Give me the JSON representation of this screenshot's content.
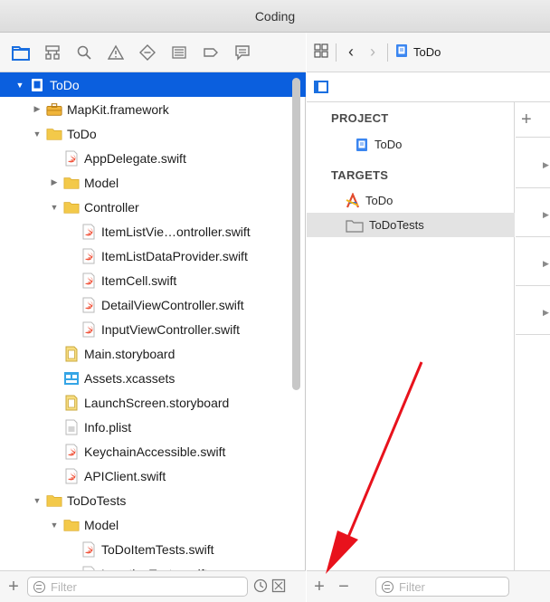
{
  "window": {
    "title": "Coding"
  },
  "navigator": {
    "tabs": [
      "project-navigator-icon",
      "source-control-icon",
      "find-icon",
      "issue-icon",
      "test-icon",
      "debug-icon",
      "breakpoint-icon",
      "report-icon"
    ],
    "tree": [
      {
        "label": "ToDo",
        "depth": 0,
        "disclosure": "open",
        "icon": "xcode-project-icon",
        "selected": true
      },
      {
        "label": "MapKit.framework",
        "depth": 1,
        "disclosure": "closed",
        "icon": "framework-icon"
      },
      {
        "label": "ToDo",
        "depth": 1,
        "disclosure": "open",
        "icon": "folder-icon"
      },
      {
        "label": "AppDelegate.swift",
        "depth": 2,
        "disclosure": "none",
        "icon": "swift-file-icon"
      },
      {
        "label": "Model",
        "depth": 2,
        "disclosure": "closed",
        "icon": "folder-icon"
      },
      {
        "label": "Controller",
        "depth": 2,
        "disclosure": "open",
        "icon": "folder-icon"
      },
      {
        "label": "ItemListVie…ontroller.swift",
        "depth": 3,
        "disclosure": "none",
        "icon": "swift-file-icon"
      },
      {
        "label": "ItemListDataProvider.swift",
        "depth": 3,
        "disclosure": "none",
        "icon": "swift-file-icon"
      },
      {
        "label": "ItemCell.swift",
        "depth": 3,
        "disclosure": "none",
        "icon": "swift-file-icon"
      },
      {
        "label": "DetailViewController.swift",
        "depth": 3,
        "disclosure": "none",
        "icon": "swift-file-icon"
      },
      {
        "label": "InputViewController.swift",
        "depth": 3,
        "disclosure": "none",
        "icon": "swift-file-icon"
      },
      {
        "label": "Main.storyboard",
        "depth": 2,
        "disclosure": "none",
        "icon": "storyboard-icon"
      },
      {
        "label": "Assets.xcassets",
        "depth": 2,
        "disclosure": "none",
        "icon": "asset-catalog-icon"
      },
      {
        "label": "LaunchScreen.storyboard",
        "depth": 2,
        "disclosure": "none",
        "icon": "storyboard-icon"
      },
      {
        "label": "Info.plist",
        "depth": 2,
        "disclosure": "none",
        "icon": "plist-icon"
      },
      {
        "label": "KeychainAccessible.swift",
        "depth": 2,
        "disclosure": "none",
        "icon": "swift-file-icon"
      },
      {
        "label": "APIClient.swift",
        "depth": 2,
        "disclosure": "none",
        "icon": "swift-file-icon"
      },
      {
        "label": "ToDoTests",
        "depth": 1,
        "disclosure": "open",
        "icon": "folder-icon"
      },
      {
        "label": "Model",
        "depth": 2,
        "disclosure": "open",
        "icon": "folder-icon"
      },
      {
        "label": "ToDoItemTests.swift",
        "depth": 3,
        "disclosure": "none",
        "icon": "swift-file-icon"
      },
      {
        "label": "LocationTests.swift",
        "depth": 3,
        "disclosure": "none",
        "icon": "swift-file-icon"
      }
    ],
    "filter_placeholder": "Filter"
  },
  "jumpbar": {
    "current": "ToDo"
  },
  "project_editor": {
    "project_header": "PROJECT",
    "project_items": [
      {
        "label": "ToDo",
        "icon": "xcode-project-icon"
      }
    ],
    "targets_header": "TARGETS",
    "target_items": [
      {
        "label": "ToDo",
        "icon": "app-target-icon",
        "highlighted": false
      },
      {
        "label": "ToDoTests",
        "icon": "test-target-icon",
        "highlighted": true
      }
    ],
    "filter_placeholder": "Filter"
  },
  "colors": {
    "selection": "#0b5fde",
    "annotation_arrow": "#e8121c",
    "folder": "#f3c94a"
  }
}
